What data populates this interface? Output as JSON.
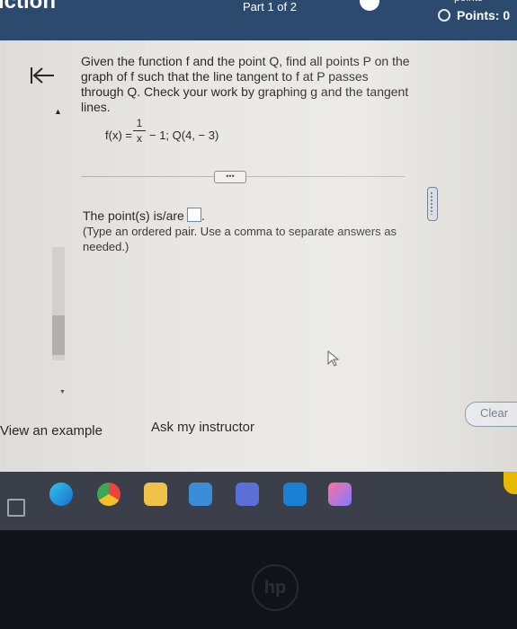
{
  "header": {
    "left_title": "iction",
    "part": "Part 1 of 2",
    "points_top": "points",
    "points_label": "Points: 0"
  },
  "question": {
    "prompt": "Given the function f and the point Q, find all points P on the graph of f such that the line tangent to f at P passes through Q. Check your work by graphing g and the tangent lines.",
    "formula_start": "f(x) =",
    "fraction_num": "1",
    "fraction_den": "x",
    "formula_tail": "− 1; Q(4, − 3)"
  },
  "answer": {
    "label": "The point(s) is/are",
    "suffix": ".",
    "hint": "(Type an ordered pair. Use a comma to separate answers as needed.)"
  },
  "expand_button": "•••",
  "footer": {
    "view_example": "View an example",
    "ask_instructor": "Ask my instructor",
    "clear": "Clear"
  },
  "colors": {
    "header_bg": "#2c4a6e",
    "screen_bg": "#e9e8e4",
    "accent_blue": "#6f86b8"
  },
  "taskbar_icons": [
    "windows-icon",
    "edge-icon",
    "chrome-icon",
    "file-explorer-icon",
    "store-icon",
    "teams-icon",
    "app-icon",
    "photos-icon"
  ]
}
